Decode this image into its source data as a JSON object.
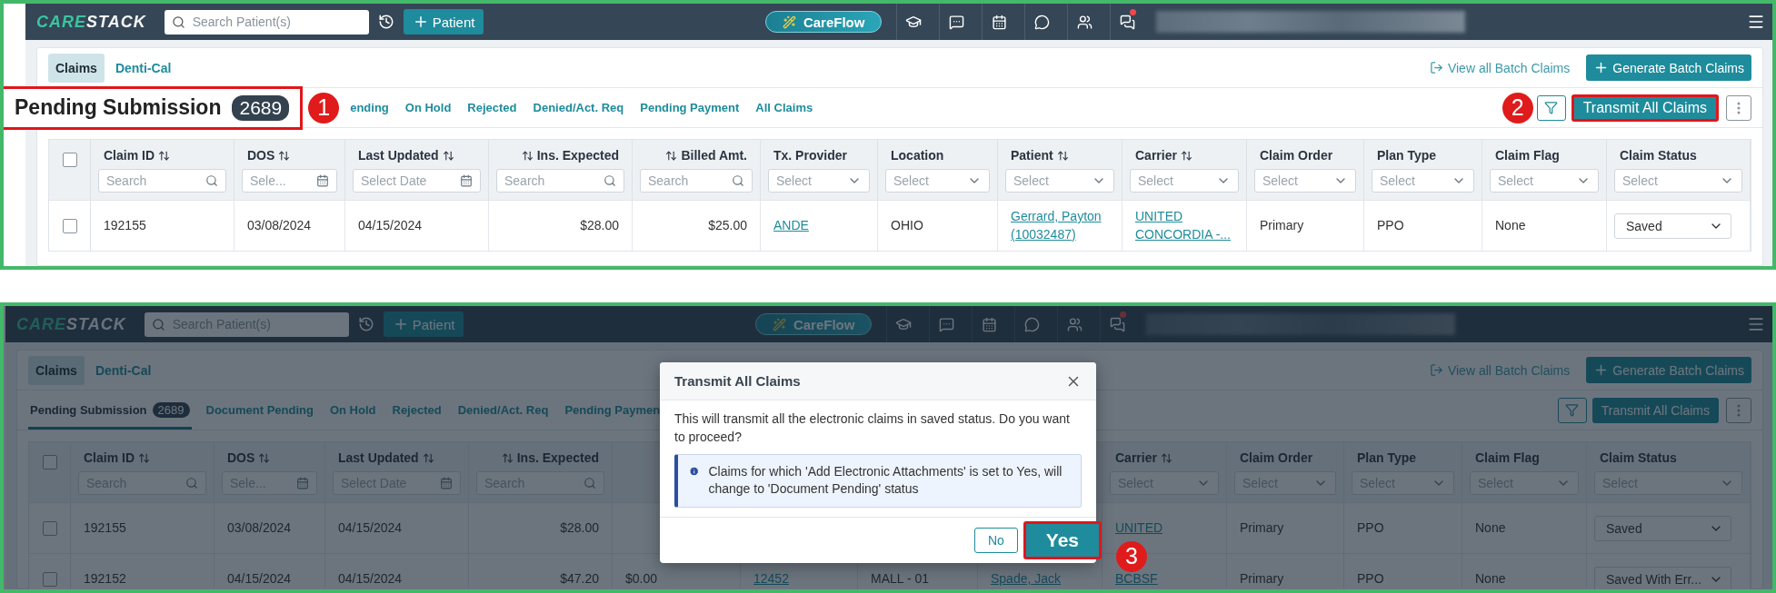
{
  "panels": [
    {
      "navbar": {
        "logo_first": "CARE",
        "logo_second": "STACK",
        "search_placeholder": "Search Patient(s)",
        "patient_button": "Patient",
        "careflow_button": "CareFlow"
      },
      "tabs": [
        {
          "label": "Claims",
          "selected": true
        },
        {
          "label": "Denti-Cal",
          "selected": false
        }
      ],
      "view_batch_link": "View all Batch Claims",
      "generate_button": "Generate Batch Claims",
      "status_tabs": [
        {
          "label": "Pending Submission",
          "count": "2689",
          "selected": true,
          "highlighted": true,
          "marker": "1"
        },
        {
          "label": "ending",
          "selected": false,
          "highlighted": false
        },
        {
          "label": "On Hold",
          "selected": false,
          "highlighted": false
        },
        {
          "label": "Rejected",
          "selected": false,
          "highlighted": false
        },
        {
          "label": "Denied/Act. Req",
          "selected": false,
          "highlighted": false
        },
        {
          "label": "Pending Payment",
          "selected": false,
          "highlighted": false
        },
        {
          "label": "All Claims",
          "selected": false,
          "highlighted": false
        }
      ],
      "transmit_button": {
        "label": "Transmit All Claims",
        "highlighted": true,
        "marker": "2"
      },
      "table": {
        "all_checked": false,
        "columns": [
          {
            "label": "Claim ID",
            "sortable": true,
            "numeric": false,
            "filter": {
              "kind": "search",
              "placeholder": "Search"
            }
          },
          {
            "label": "DOS",
            "sortable": true,
            "numeric": false,
            "filter": {
              "kind": "date",
              "placeholder": "Sele..."
            }
          },
          {
            "label": "Last Updated",
            "sortable": true,
            "numeric": false,
            "filter": {
              "kind": "date",
              "placeholder": "Select Date"
            }
          },
          {
            "label": "Ins. Expected",
            "sortable": true,
            "numeric": true,
            "filter": {
              "kind": "search",
              "placeholder": "Search"
            }
          },
          {
            "label": "Billed Amt.",
            "sortable": true,
            "numeric": true,
            "filter": {
              "kind": "search",
              "placeholder": "Search"
            }
          },
          {
            "label": "Tx. Provider",
            "sortable": false,
            "numeric": false,
            "filter": {
              "kind": "select",
              "placeholder": "Select"
            }
          },
          {
            "label": "Location",
            "sortable": false,
            "numeric": false,
            "filter": {
              "kind": "select",
              "placeholder": "Select"
            }
          },
          {
            "label": "Patient",
            "sortable": true,
            "numeric": false,
            "filter": {
              "kind": "select",
              "placeholder": "Select"
            }
          },
          {
            "label": "Carrier",
            "sortable": true,
            "numeric": false,
            "filter": {
              "kind": "select",
              "placeholder": "Select"
            }
          },
          {
            "label": "Claim Order",
            "sortable": false,
            "numeric": false,
            "filter": {
              "kind": "select",
              "placeholder": "Select"
            }
          },
          {
            "label": "Plan Type",
            "sortable": false,
            "numeric": false,
            "filter": {
              "kind": "select",
              "placeholder": "Select"
            }
          },
          {
            "label": "Claim Flag",
            "sortable": false,
            "numeric": false,
            "filter": {
              "kind": "select",
              "placeholder": "Select"
            }
          },
          {
            "label": "Claim Status",
            "sortable": false,
            "numeric": false,
            "filter": {
              "kind": "select",
              "placeholder": "Select"
            }
          }
        ],
        "rows": [
          {
            "checked": false,
            "cells": [
              {
                "kind": "text",
                "text": "192155"
              },
              {
                "kind": "text",
                "text": "03/08/2024"
              },
              {
                "kind": "text",
                "text": "04/15/2024"
              },
              {
                "kind": "text",
                "text": "$28.00"
              },
              {
                "kind": "text",
                "text": "$25.00"
              },
              {
                "kind": "link",
                "text": "ANDE"
              },
              {
                "kind": "text",
                "text": "OHIO"
              },
              {
                "kind": "link",
                "text": "Gerrard, Payton (10032487)"
              },
              {
                "kind": "link",
                "text": "UNITED CONCORDIA -..."
              },
              {
                "kind": "text",
                "text": "Primary"
              },
              {
                "kind": "text",
                "text": "PPO"
              },
              {
                "kind": "text",
                "text": "None"
              },
              {
                "kind": "select",
                "text": "Saved"
              }
            ]
          }
        ]
      }
    },
    {
      "navbar": {
        "logo_first": "CARE",
        "logo_second": "STACK",
        "search_placeholder": "Search Patient(s)",
        "patient_button": "Patient",
        "careflow_button": "CareFlow"
      },
      "tabs": [
        {
          "label": "Claims",
          "selected": true
        },
        {
          "label": "Denti-Cal",
          "selected": false
        }
      ],
      "view_batch_link": "View all Batch Claims",
      "generate_button": "Generate Batch Claims",
      "status_tabs": [
        {
          "label": "Pending Submission",
          "count": "2689",
          "selected": true,
          "highlighted": false
        },
        {
          "label": "Document Pending",
          "selected": false,
          "highlighted": false
        },
        {
          "label": "On Hold",
          "selected": false,
          "highlighted": false
        },
        {
          "label": "Rejected",
          "selected": false,
          "highlighted": false
        },
        {
          "label": "Denied/Act. Req",
          "selected": false,
          "highlighted": false
        },
        {
          "label": "Pending Paymen",
          "selected": false,
          "highlighted": false
        }
      ],
      "transmit_button": {
        "label": "Transmit All Claims",
        "highlighted": false
      },
      "table": {
        "all_checked": false,
        "columns": [
          {
            "label": "Claim ID",
            "sortable": true,
            "numeric": false,
            "filter": {
              "kind": "search",
              "placeholder": "Search"
            }
          },
          {
            "label": "DOS",
            "sortable": true,
            "numeric": false,
            "filter": {
              "kind": "date",
              "placeholder": "Sele..."
            }
          },
          {
            "label": "Last Updated",
            "sortable": true,
            "numeric": false,
            "filter": {
              "kind": "date",
              "placeholder": "Select Date"
            }
          },
          {
            "label": "Ins. Expected",
            "sortable": true,
            "numeric": true,
            "filter": {
              "kind": "search",
              "placeholder": "Search"
            }
          },
          null,
          null,
          null,
          null,
          {
            "label": "Carrier",
            "sortable": true,
            "numeric": false,
            "filter": {
              "kind": "select",
              "placeholder": "Select"
            }
          },
          {
            "label": "Claim Order",
            "sortable": false,
            "numeric": false,
            "filter": {
              "kind": "select",
              "placeholder": "Select"
            }
          },
          {
            "label": "Plan Type",
            "sortable": false,
            "numeric": false,
            "filter": {
              "kind": "select",
              "placeholder": "Select"
            }
          },
          {
            "label": "Claim Flag",
            "sortable": false,
            "numeric": false,
            "filter": {
              "kind": "select",
              "placeholder": "Select"
            }
          },
          {
            "label": "Claim Status",
            "sortable": false,
            "numeric": false,
            "filter": {
              "kind": "select",
              "placeholder": "Select"
            }
          }
        ],
        "rows": [
          {
            "checked": false,
            "cells": [
              {
                "kind": "text",
                "text": "192155"
              },
              {
                "kind": "text",
                "text": "03/08/2024"
              },
              {
                "kind": "text",
                "text": "04/15/2024"
              },
              {
                "kind": "text",
                "text": "$28.00"
              },
              null,
              null,
              null,
              null,
              {
                "kind": "link",
                "text": "UNITED"
              },
              {
                "kind": "text",
                "text": "Primary"
              },
              {
                "kind": "text",
                "text": "PPO"
              },
              {
                "kind": "text",
                "text": "None"
              },
              {
                "kind": "select",
                "text": "Saved"
              }
            ]
          },
          {
            "checked": false,
            "cells": [
              {
                "kind": "text",
                "text": "192152"
              },
              {
                "kind": "text",
                "text": "04/15/2024"
              },
              {
                "kind": "text",
                "text": "04/15/2024"
              },
              {
                "kind": "text",
                "text": "$47.20"
              },
              {
                "kind": "text",
                "text": "$0.00"
              },
              {
                "kind": "link",
                "text": "12452"
              },
              {
                "kind": "text",
                "text": "MALL - 01"
              },
              {
                "kind": "link",
                "text": "Spade, Jack"
              },
              {
                "kind": "link",
                "text": "BCBSF"
              },
              {
                "kind": "text",
                "text": "Primary"
              },
              {
                "kind": "text",
                "text": "PPO"
              },
              {
                "kind": "text",
                "text": "None"
              },
              {
                "kind": "select",
                "text": "Saved With Err..."
              }
            ]
          }
        ]
      },
      "dialog": {
        "title": "Transmit All Claims",
        "message": "This will transmit all the electronic claims in saved status. Do you want to proceed?",
        "notice": "Claims for which 'Add Electronic Attachments' is set to Yes, will change to 'Document Pending' status",
        "no_button": {
          "label": "No",
          "highlighted": false
        },
        "yes_button": {
          "label": "Yes",
          "highlighted": true,
          "marker": "3"
        }
      }
    }
  ]
}
